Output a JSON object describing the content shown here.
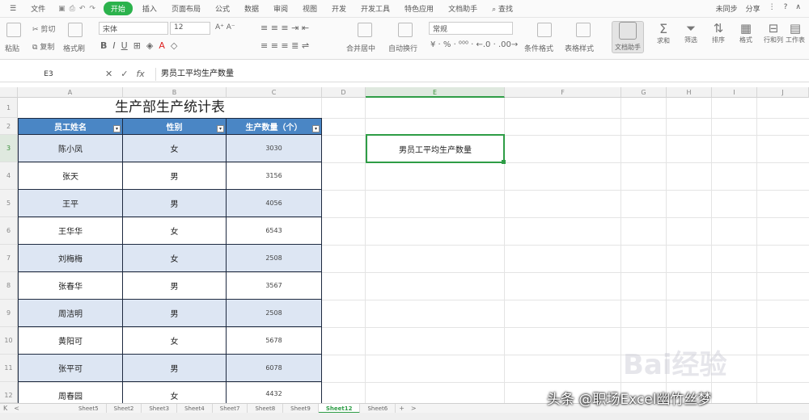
{
  "menu": {
    "file_label": "文件",
    "items": [
      "开始",
      "插入",
      "页面布局",
      "公式",
      "数据",
      "审阅",
      "视图",
      "开发",
      "开发工具",
      "特色应用",
      "文档助手",
      "查找"
    ],
    "right": [
      "未同步",
      "分享"
    ]
  },
  "ribbon": {
    "font_name": "宋体",
    "font_size": "12",
    "number_format": "常规",
    "cut_label": "剪切",
    "copy_label": "复制",
    "paste_label": "粘贴",
    "format_painter_label": "格式刷",
    "merge_label": "合并居中",
    "wrap_label": "自动换行",
    "cond_format_label": "条件格式",
    "table_style_label": "表格样式",
    "doc_helper_label": "文档助手",
    "sum_label": "求和",
    "filter_label": "筛选",
    "sort_label": "排序",
    "format_label": "格式",
    "rowcol_label": "行和列",
    "sheet_label": "工作表"
  },
  "formula_bar": {
    "cell_ref": "E3",
    "content": "男员工平均生产数量"
  },
  "columns": [
    "A",
    "B",
    "C",
    "D",
    "E",
    "F",
    "G",
    "H",
    "I",
    "J"
  ],
  "rows": [
    "1",
    "2",
    "3",
    "4",
    "5",
    "6",
    "7",
    "8",
    "9",
    "10",
    "11",
    "12"
  ],
  "sheet": {
    "title": "生产部生产统计表",
    "headers": [
      "员工姓名",
      "性别",
      "生产数量（个）"
    ],
    "records": [
      {
        "name": "陈小凤",
        "gender": "女",
        "qty": "3030"
      },
      {
        "name": "张天",
        "gender": "男",
        "qty": "3156"
      },
      {
        "name": "王平",
        "gender": "男",
        "qty": "4056"
      },
      {
        "name": "王华华",
        "gender": "女",
        "qty": "6543"
      },
      {
        "name": "刘梅梅",
        "gender": "女",
        "qty": "2508"
      },
      {
        "name": "张春华",
        "gender": "男",
        "qty": "3567"
      },
      {
        "name": "周洁明",
        "gender": "男",
        "qty": "2508"
      },
      {
        "name": "黄阳可",
        "gender": "女",
        "qty": "5678"
      },
      {
        "name": "张平可",
        "gender": "男",
        "qty": "6078"
      },
      {
        "name": "周春园",
        "gender": "女",
        "qty": "4432"
      }
    ],
    "selected_cell_text": "男员工平均生产数量"
  },
  "tabs": [
    "Sheet5",
    "Sheet2",
    "Sheet3",
    "Sheet4",
    "Sheet7",
    "Sheet8",
    "Sheet9",
    "Sheet12",
    "Sheet6"
  ],
  "active_tab": "Sheet12",
  "watermark": "头条 @职场Excel幽竹丝梦",
  "watermark_logo": "Bai经验",
  "colors": {
    "accent": "#2e9d46",
    "header_fill": "#4a86c5",
    "band_fill": "#dde6f3"
  }
}
